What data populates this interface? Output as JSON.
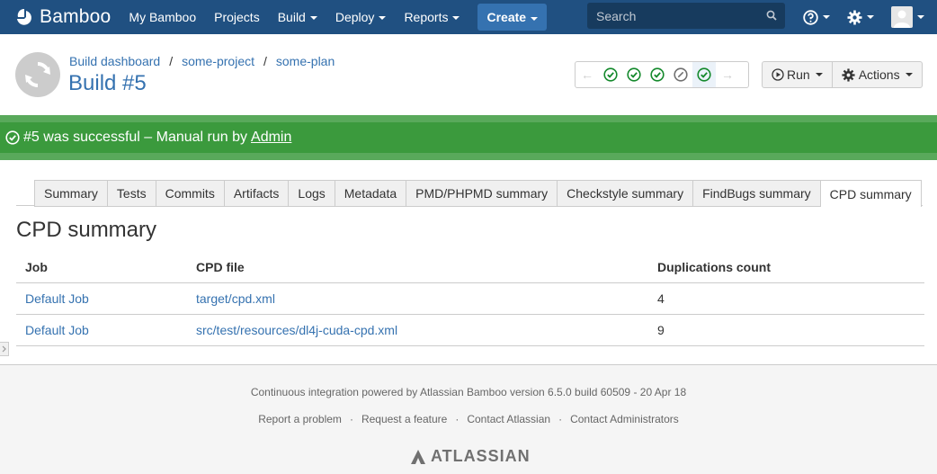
{
  "header": {
    "app_name": "Bamboo",
    "nav": [
      {
        "label": "My Bamboo"
      },
      {
        "label": "Projects"
      },
      {
        "label": "Build"
      },
      {
        "label": "Deploy"
      },
      {
        "label": "Reports"
      }
    ],
    "create_label": "Create",
    "search_placeholder": "Search"
  },
  "page": {
    "breadcrumbs": [
      "Build dashboard",
      "some-project",
      "some-plan"
    ],
    "title": "Build #5",
    "run_label": "Run",
    "actions_label": "Actions",
    "history": [
      "success",
      "success",
      "success",
      "not-built",
      "success"
    ]
  },
  "banner": {
    "text": "#5 was successful – Manual run by",
    "user": "Admin",
    "color": "#3b9a3d"
  },
  "tabs": [
    "Summary",
    "Tests",
    "Commits",
    "Artifacts",
    "Logs",
    "Metadata",
    "PMD/PHPMD summary",
    "Checkstyle summary",
    "FindBugs summary",
    "CPD summary"
  ],
  "active_tab": "CPD summary",
  "section_title": "CPD summary",
  "table": {
    "columns": [
      "Job",
      "CPD file",
      "Duplications count"
    ],
    "rows": [
      {
        "job": "Default Job",
        "file": "target/cpd.xml",
        "count": "4"
      },
      {
        "job": "Default Job",
        "file": "src/test/resources/dl4j-cuda-cpd.xml",
        "count": "9"
      }
    ]
  },
  "footer": {
    "powered_by": "Continuous integration powered by Atlassian Bamboo version 6.5.0 build 60509 - 20 Apr 18",
    "links": [
      "Report a problem",
      "Request a feature",
      "Contact Atlassian",
      "Contact Administrators"
    ],
    "brand": "ATLASSIAN"
  },
  "colors": {
    "header_bg": "#205081",
    "link": "#3572b0",
    "success": "#3b9a3d"
  }
}
